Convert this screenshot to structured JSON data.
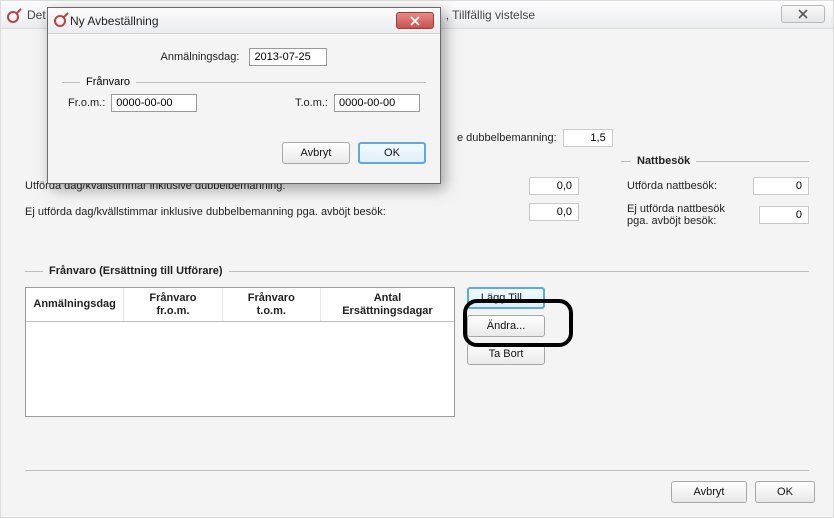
{
  "main_window": {
    "title_prefix": "Det",
    "title_suffix": ", Tillfällig vistelse"
  },
  "section_dagkvall": {
    "dubbelbemanning_label": "e dubbelbemanning:",
    "dubbelbemanning_value": "1,5",
    "utforda_label": "Utförda dag/kvällstimmar inklusive dubbelbemanning:",
    "utforda_value": "0,0",
    "ej_utforda_label": "Ej utförda dag/kvällstimmar inklusive dubbelbemanning pga. avböjt besök:",
    "ej_utforda_value": "0,0"
  },
  "section_natt": {
    "title": "Nattbesök",
    "utforda_label": "Utförda nattbesök:",
    "utforda_value": "0",
    "ej_utforda_label": "Ej utförda nattbesök pga. avböjt besök:",
    "ej_utforda_value": "0"
  },
  "section_franvaro": {
    "title": "Frånvaro (Ersättning till Utförare)",
    "columns": {
      "c1": "Anmälningsdag",
      "c2a": "Frånvaro",
      "c2b": "fr.o.m.",
      "c3a": "Frånvaro",
      "c3b": "t.o.m.",
      "c4a": "Antal",
      "c4b": "Ersättningsdagar"
    },
    "add_label": "Lägg Till...",
    "edit_label": "Ändra...",
    "delete_label": "Ta Bort"
  },
  "bottom": {
    "cancel": "Avbryt",
    "ok": "OK"
  },
  "modal": {
    "title": "Ny Avbeställning",
    "anmalningsdag_label": "Anmälningsdag:",
    "anmalningsdag_value": "2013-07-25",
    "group_title": "Frånvaro",
    "from_label": "Fr.o.m.:",
    "from_value": "0000-00-00",
    "tom_label": "T.o.m.:",
    "tom_value": "0000-00-00",
    "cancel": "Avbryt",
    "ok": "OK"
  }
}
